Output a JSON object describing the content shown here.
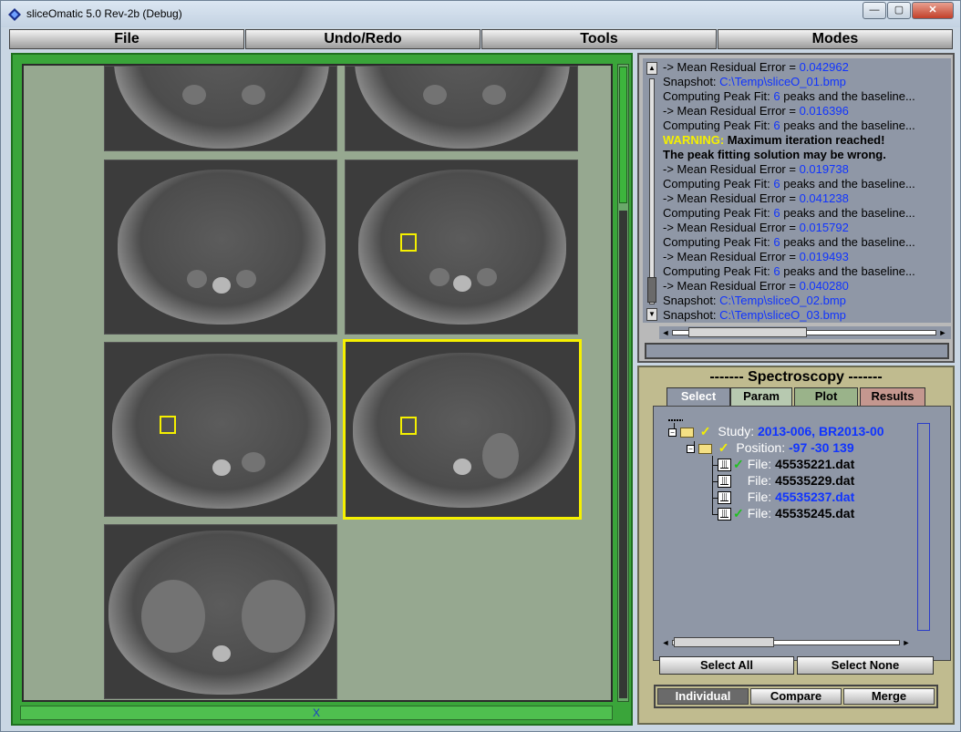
{
  "window": {
    "title": "sliceOmatic 5.0 Rev-2b (Debug)",
    "controls": {
      "minimize": "—",
      "maximize": "▢",
      "close": "✕"
    }
  },
  "menu": [
    "File",
    "Undo/Redo",
    "Tools",
    "Modes"
  ],
  "viewer": {
    "hbar_label": "X",
    "slices": [
      {
        "row": 0,
        "col": 0,
        "selected": false,
        "roi": false
      },
      {
        "row": 0,
        "col": 1,
        "selected": false,
        "roi": false
      },
      {
        "row": 1,
        "col": 0,
        "selected": false,
        "roi": false
      },
      {
        "row": 1,
        "col": 1,
        "selected": false,
        "roi": true
      },
      {
        "row": 2,
        "col": 0,
        "selected": false,
        "roi": true
      },
      {
        "row": 2,
        "col": 1,
        "selected": true,
        "roi": true
      },
      {
        "row": 3,
        "col": 0,
        "selected": false,
        "roi": false
      }
    ]
  },
  "log": {
    "lines": [
      {
        "type": "kv",
        "label": "  -> Mean Residual Error = ",
        "value": "0.042962"
      },
      {
        "type": "kv",
        "label": "Snapshot: ",
        "value": "C:\\Temp\\sliceO_01.bmp"
      },
      {
        "type": "peak",
        "label": "Computing Peak Fit: ",
        "value": "6",
        "suffix": " peaks and the baseline..."
      },
      {
        "type": "kv",
        "label": "  -> Mean Residual Error = ",
        "value": "0.016396"
      },
      {
        "type": "peak",
        "label": "Computing Peak Fit: ",
        "value": "6",
        "suffix": " peaks and the baseline..."
      },
      {
        "type": "warn",
        "label": "WARNING: ",
        "value": "Maximum iteration reached!"
      },
      {
        "type": "bold",
        "label": "The peak fitting solution may be wrong."
      },
      {
        "type": "kv",
        "label": "  -> Mean Residual Error = ",
        "value": "0.019738"
      },
      {
        "type": "peak",
        "label": "Computing Peak Fit: ",
        "value": "6",
        "suffix": " peaks and the baseline..."
      },
      {
        "type": "kv",
        "label": "  -> Mean Residual Error = ",
        "value": "0.041238"
      },
      {
        "type": "peak",
        "label": "Computing Peak Fit: ",
        "value": "6",
        "suffix": " peaks and the baseline..."
      },
      {
        "type": "kv",
        "label": "  -> Mean Residual Error = ",
        "value": "0.015792"
      },
      {
        "type": "peak",
        "label": "Computing Peak Fit: ",
        "value": "6",
        "suffix": " peaks and the baseline..."
      },
      {
        "type": "kv",
        "label": "  -> Mean Residual Error = ",
        "value": "0.019493"
      },
      {
        "type": "peak",
        "label": "Computing Peak Fit: ",
        "value": "6",
        "suffix": " peaks and the baseline..."
      },
      {
        "type": "kv",
        "label": "  -> Mean Residual Error = ",
        "value": "0.040280"
      },
      {
        "type": "kv",
        "label": "Snapshot: ",
        "value": "C:\\Temp\\sliceO_02.bmp"
      },
      {
        "type": "kv",
        "label": "Snapshot: ",
        "value": "C:\\Temp\\sliceO_03.bmp"
      }
    ],
    "input_value": ""
  },
  "spectroscopy": {
    "title": "------- Spectroscopy -------",
    "tabs": [
      "Select",
      "Param",
      "Plot",
      "Results"
    ],
    "active_tab": "Select",
    "tree": {
      "study": {
        "label": "Study: ",
        "value": "2013-006, BR2013-00"
      },
      "position": {
        "label": "Position: ",
        "value": "-97 -30 139"
      },
      "files": [
        {
          "label": "File: ",
          "value": "45535221.dat",
          "checked": true,
          "selected": false
        },
        {
          "label": "File: ",
          "value": "45535229.dat",
          "checked": false,
          "selected": false
        },
        {
          "label": "File: ",
          "value": "45535237.dat",
          "checked": false,
          "selected": true
        },
        {
          "label": "File: ",
          "value": "45535245.dat",
          "checked": true,
          "selected": false
        }
      ]
    },
    "select_all": "Select All",
    "select_none": "Select None",
    "modes": [
      "Individual",
      "Compare",
      "Merge"
    ],
    "active_mode": "Individual"
  },
  "colors": {
    "viewer_frame": "#3aa53a",
    "viewer_bg": "#96a890",
    "selected_slice": "#f5f000",
    "log_value": "#1034ff",
    "warning": "#f5f000",
    "check": "#20c020"
  }
}
